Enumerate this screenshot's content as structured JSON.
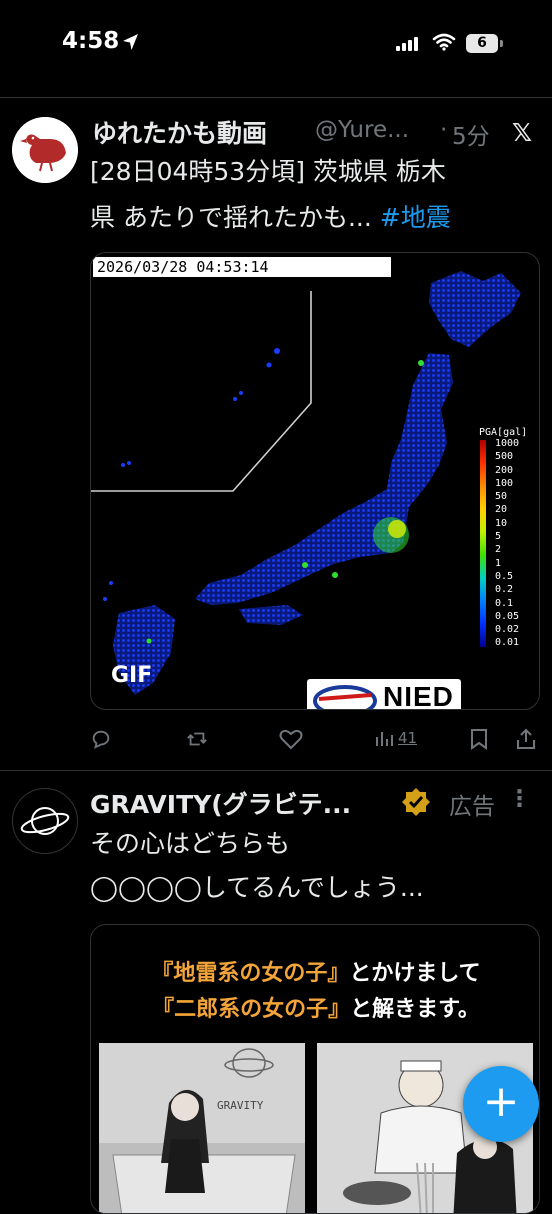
{
  "status_bar": {
    "time": "4:58",
    "battery": "6",
    "icons": [
      "location-arrow-icon",
      "signal-icon",
      "wifi-icon",
      "battery-icon"
    ]
  },
  "tweet1": {
    "display_name": "ゆれたかも動画",
    "handle": "@Yure...",
    "separator": "·",
    "time": "5分",
    "platform_logo": "𝕏",
    "text_line1": "[28日04時53分頃] 茨城県 栃木",
    "text_line2": "県 あたりで揺れたかも...",
    "hashtag": "#地震",
    "media": {
      "timestamp": "2026/03/28 04:53:14",
      "legend_title": "PGA[gal]",
      "legend_values": [
        "1000",
        "500",
        "200",
        "100",
        "50",
        "20",
        "10",
        "5",
        "2",
        "1",
        "0.5",
        "0.2",
        "0.1",
        "0.05",
        "0.02",
        "0.01"
      ],
      "gif_badge": "GIF",
      "logo_text": "NIED"
    },
    "actions": {
      "views_count": "41"
    }
  },
  "tweet2": {
    "display_name": "GRAVITY(グラビテ...",
    "ad_label": "広告",
    "more": "⋮",
    "text_line1": "その心はどちらも",
    "text_line2": "◯◯◯◯してるんでしょう...",
    "media": {
      "headline1_highlight": "『地雷系の女の子』",
      "headline1_rest": "とかけまして",
      "headline2_highlight": "『二郎系の女の子』",
      "headline2_rest": "と解きます。",
      "panel_sign": "GRAVITY"
    }
  },
  "fab": {
    "label": "+"
  },
  "colors": {
    "background": "#000000",
    "accent": "#1d9bf0",
    "muted": "#71767b",
    "text": "#e7e9ea",
    "ad_highlight": "#f4a53a",
    "verified": "#d4a017"
  }
}
